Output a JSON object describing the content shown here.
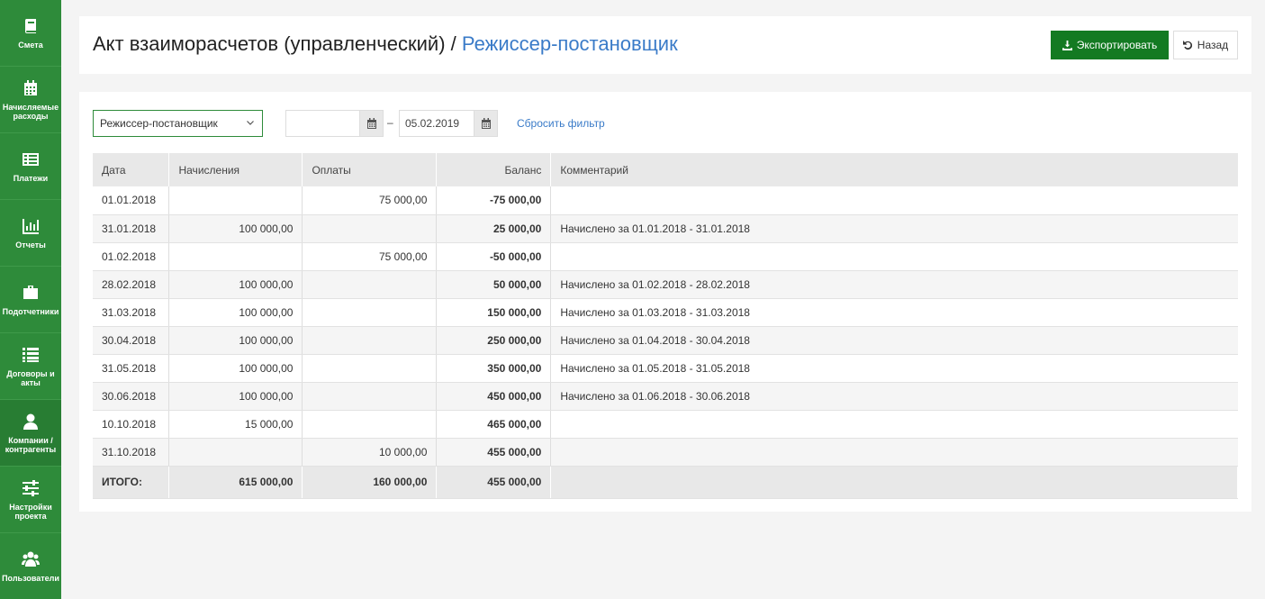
{
  "sidebar": {
    "items": [
      {
        "label": "Смета",
        "icon": "book-icon"
      },
      {
        "label": "Начисляемые расходы",
        "icon": "calendar-icon"
      },
      {
        "label": "Платежи",
        "icon": "list-icon"
      },
      {
        "label": "Отчеты",
        "icon": "bar-chart-icon"
      },
      {
        "label": "Подотчетники",
        "icon": "briefcase-icon"
      },
      {
        "label": "Договоры и акты",
        "icon": "list-lines-icon"
      },
      {
        "label": "Компании / контрагенты",
        "icon": "user-icon"
      },
      {
        "label": "Настройки проекта",
        "icon": "sliders-icon"
      },
      {
        "label": "Пользователи",
        "icon": "users-icon"
      }
    ]
  },
  "header": {
    "title": "Акт взаиморасчетов (управленческий) /",
    "title_accent": "Режиссер-постановщик",
    "export_label": "Экспортировать",
    "back_label": "Назад"
  },
  "filters": {
    "select_value": "Режиссер-постановщик",
    "date_from": "",
    "date_to": "05.02.2019",
    "dash": "–",
    "reset_label": "Сбросить фильтр"
  },
  "table": {
    "columns": [
      "Дата",
      "Начисления",
      "Оплаты",
      "Баланс",
      "Комментарий"
    ],
    "rows": [
      [
        "01.01.2018",
        "",
        "75 000,00",
        "-75 000,00",
        ""
      ],
      [
        "31.01.2018",
        "100 000,00",
        "",
        "25 000,00",
        "Начислено за 01.01.2018 - 31.01.2018"
      ],
      [
        "01.02.2018",
        "",
        "75 000,00",
        "-50 000,00",
        ""
      ],
      [
        "28.02.2018",
        "100 000,00",
        "",
        "50 000,00",
        "Начислено за 01.02.2018 - 28.02.2018"
      ],
      [
        "31.03.2018",
        "100 000,00",
        "",
        "150 000,00",
        "Начислено за 01.03.2018 - 31.03.2018"
      ],
      [
        "30.04.2018",
        "100 000,00",
        "",
        "250 000,00",
        "Начислено за 01.04.2018 - 30.04.2018"
      ],
      [
        "31.05.2018",
        "100 000,00",
        "",
        "350 000,00",
        "Начислено за 01.05.2018 - 31.05.2018"
      ],
      [
        "30.06.2018",
        "100 000,00",
        "",
        "450 000,00",
        "Начислено за 01.06.2018 - 30.06.2018"
      ],
      [
        "10.10.2018",
        "15 000,00",
        "",
        "465 000,00",
        ""
      ],
      [
        "31.10.2018",
        "",
        "10 000,00",
        "455 000,00",
        ""
      ]
    ],
    "total": [
      "ИТОГО:",
      "615 000,00",
      "160 000,00",
      "455 000,00",
      ""
    ]
  },
  "colors": {
    "sidebar": "#2e8b3a",
    "export_button": "#137a22",
    "accent_text": "#3a7bc8"
  }
}
